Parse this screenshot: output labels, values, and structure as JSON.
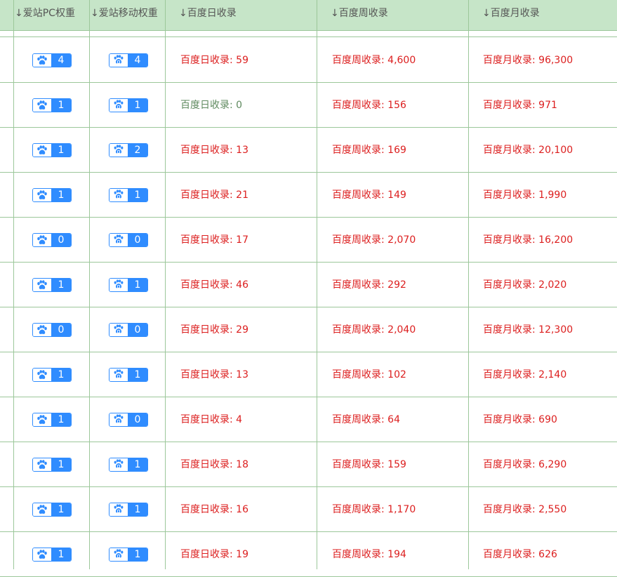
{
  "header": {
    "columns": [
      "↓爱站PC权重",
      "↓爱站移动权重",
      "↓百度日收录",
      "↓百度周收录",
      "↓百度月收录"
    ]
  },
  "rows": [
    {
      "pc": "4",
      "mobile": "4",
      "day": "百度日收录: 59",
      "week": "百度周收录: 4,600",
      "month": "百度月收录: 96,300"
    },
    {
      "pc": "1",
      "mobile": "1",
      "day": "百度日收录: 0",
      "week": "百度周收录: 156",
      "month": "百度月收录: 971"
    },
    {
      "pc": "1",
      "mobile": "2",
      "day": "百度日收录: 13",
      "week": "百度周收录: 169",
      "month": "百度月收录: 20,100"
    },
    {
      "pc": "1",
      "mobile": "1",
      "day": "百度日收录: 21",
      "week": "百度周收录: 149",
      "month": "百度月收录: 1,990"
    },
    {
      "pc": "0",
      "mobile": "0",
      "day": "百度日收录: 17",
      "week": "百度周收录: 2,070",
      "month": "百度月收录: 16,200"
    },
    {
      "pc": "1",
      "mobile": "1",
      "day": "百度日收录: 46",
      "week": "百度周收录: 292",
      "month": "百度月收录: 2,020"
    },
    {
      "pc": "0",
      "mobile": "0",
      "day": "百度日收录: 29",
      "week": "百度周收录: 2,040",
      "month": "百度月收录: 12,300"
    },
    {
      "pc": "1",
      "mobile": "1",
      "day": "百度日收录: 13",
      "week": "百度周收录: 102",
      "month": "百度月收录: 2,140"
    },
    {
      "pc": "1",
      "mobile": "0",
      "day": "百度日收录: 4",
      "week": "百度周收录: 64",
      "month": "百度月收录: 690"
    },
    {
      "pc": "1",
      "mobile": "1",
      "day": "百度日收录: 18",
      "week": "百度周收录: 159",
      "month": "百度月收录: 6,290"
    },
    {
      "pc": "1",
      "mobile": "1",
      "day": "百度日收录: 16",
      "week": "百度周收录: 1,170",
      "month": "百度月收录: 2,550"
    },
    {
      "pc": "1",
      "mobile": "1",
      "day": "百度日收录: 19",
      "week": "百度周收录: 194",
      "month": "百度月收录: 626"
    }
  ],
  "icons": {
    "pc_badge": "paw-icon",
    "mobile_badge": "mobile-paw-icon"
  },
  "colors": {
    "header_bg": "#c6e5c8",
    "border": "#9cc79a",
    "badge_blue": "#2f8cff",
    "value_red": "#dc1e1e",
    "zero_green": "#5f8a5f"
  }
}
